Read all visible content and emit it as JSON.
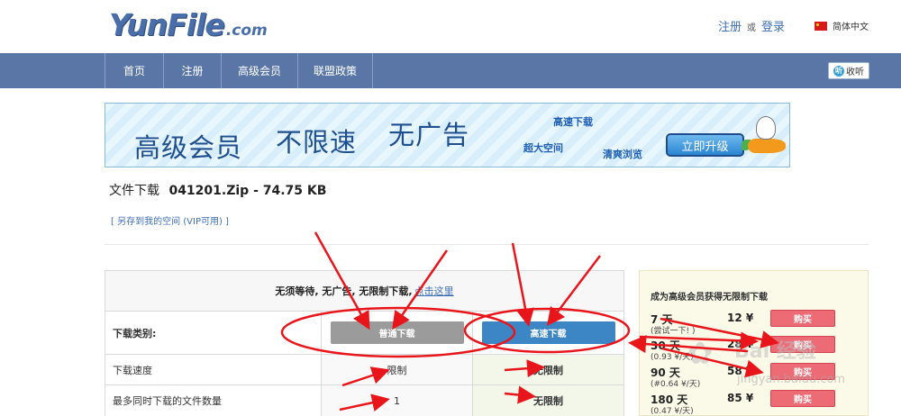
{
  "logo": {
    "main": "YunFile",
    "domain": ".com"
  },
  "header": {
    "register": "注册",
    "or": "或",
    "login": "登录",
    "language": "简体中文"
  },
  "nav": {
    "items": [
      {
        "label": "首页"
      },
      {
        "label": "注册"
      },
      {
        "label": "高级会员"
      },
      {
        "label": "联盟政策"
      }
    ],
    "listen_label": "收听",
    "listen_icon_text": "听"
  },
  "banner": {
    "headline_1": "高级会员",
    "headline_2": "不限速",
    "headline_3": "无广告",
    "feature_1": "高速下载",
    "feature_2": "超大空间",
    "feature_3": "清爽浏览",
    "upgrade_button": "立即升级"
  },
  "file": {
    "label": "文件下载",
    "name": "041201.Zip - 74.75 KB",
    "save_link": "[ 另存到我的空间 (VIP可用) ]"
  },
  "download_table": {
    "header_text": "无须等待, 无广告, 无限制下载,",
    "header_link": "点击这里",
    "rows": [
      {
        "label": "下载类别:",
        "normal": "普通下载",
        "fast": "高速下载"
      },
      {
        "label": "下载速度",
        "normal": "限制",
        "fast": "无限制"
      },
      {
        "label": "最多同时下载的文件数量",
        "normal": "1",
        "fast": "无限制"
      }
    ]
  },
  "vip_panel": {
    "title": "成为高级会员获得无限制下载",
    "plans": [
      {
        "days": "7 天",
        "note": "(尝试一下! )",
        "price": "12 ¥",
        "buy": "购买"
      },
      {
        "days": "30 天",
        "note": "(0.93 ¥/天)",
        "price": "28 ¥",
        "buy": "购买"
      },
      {
        "days": "90 天",
        "note": "(#0.64 ¥/天)",
        "price": "58 ¥",
        "buy": "购买"
      },
      {
        "days": "180 天",
        "note": "(0.47 ¥/天)",
        "price": "85 ¥",
        "buy": "购买"
      }
    ]
  },
  "watermark": {
    "text": "Bai 经验",
    "sub": "jingyan.baidu.com"
  },
  "colors": {
    "nav": "#5976a6",
    "link": "#3f6fb5",
    "buy": "#ec6b75",
    "fast_button": "#3d86c6",
    "annotation": "#e8151b"
  }
}
